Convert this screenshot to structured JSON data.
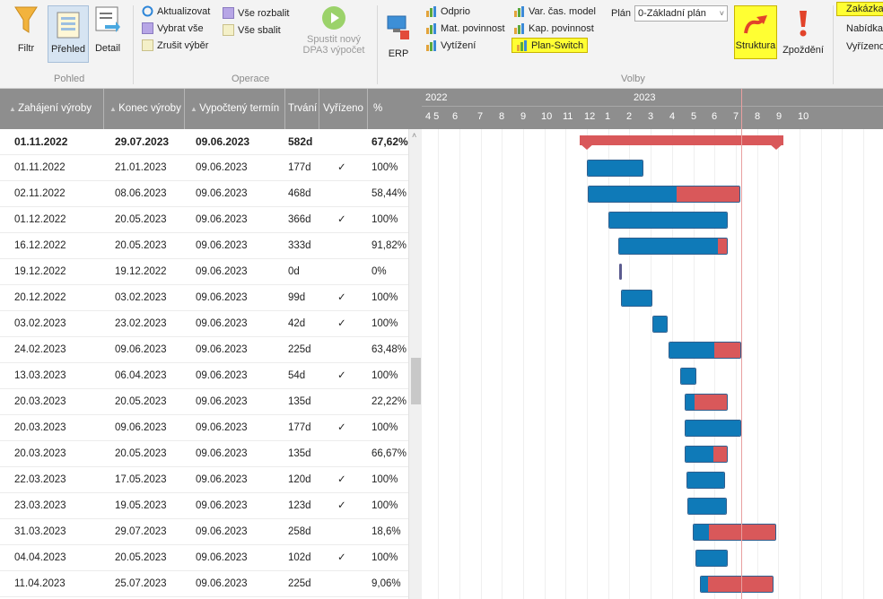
{
  "ribbon": {
    "filtr": "Filtr",
    "prehled": "Přehled",
    "detail": "Detail",
    "pohled": "Pohled",
    "aktualizovat": "Aktualizovat",
    "vybrat_vse": "Vybrat vše",
    "zrusit_vyber": "Zrušit výběr",
    "vse_rozbalit": "Vše rozbalit",
    "vse_sbalit": "Vše sbalit",
    "spustit_1": "Spustit nový",
    "spustit_2": "DPA3 výpočet",
    "operace": "Operace",
    "erp": "ERP",
    "odprio": "Odprio",
    "mat_povinnost": "Mat. povinnost",
    "vytizeni": "Vytížení",
    "var_cas_model": "Var. čas. model",
    "kap_povinnost": "Kap. povinnost",
    "plan_switch": "Plan-Switch",
    "plan_label": "Plán",
    "plan_value": "0-Základní plán",
    "volby": "Volby",
    "struktura": "Struktura",
    "zpozdeni": "Zpoždění",
    "zakazka": "Zakázka",
    "nabidka": "Nabídka",
    "vyrizeno": "Vyřízeno"
  },
  "columns": {
    "zahajeni": "Zahájení výroby",
    "konec": "Konec výroby",
    "vypocteny": "Vypočtený termín",
    "trvani": "Trvání",
    "vyrizeno": "Vyřízeno",
    "pct": "%"
  },
  "timeline": {
    "year1": "2022",
    "year2": "2023",
    "months": [
      "4 5",
      "6",
      "7",
      "8",
      "9",
      "10",
      "11",
      "12",
      "1",
      "2",
      "3",
      "4",
      "5",
      "6",
      "7",
      "8",
      "9",
      "10"
    ]
  },
  "rows": [
    {
      "start": "01.11.2022",
      "end": "29.07.2023",
      "calc": "09.06.2023",
      "dur": "582d",
      "done": "",
      "pct": "67,62%",
      "bold": true,
      "summary": true,
      "sd": "2022-11-01",
      "ed": "2023-07-29"
    },
    {
      "start": "01.11.2022",
      "end": "21.01.2023",
      "calc": "09.06.2023",
      "dur": "177d",
      "done": "✓",
      "pct": "100%",
      "pct_value": 1.0,
      "sd": "2022-11-01",
      "ed": "2023-01-21"
    },
    {
      "start": "02.11.2022",
      "end": "08.06.2023",
      "calc": "09.06.2023",
      "dur": "468d",
      "done": "",
      "pct": "58,44%",
      "pct_value": 0.5844,
      "sd": "2022-11-02",
      "ed": "2023-06-08"
    },
    {
      "start": "01.12.2022",
      "end": "20.05.2023",
      "calc": "09.06.2023",
      "dur": "366d",
      "done": "✓",
      "pct": "100%",
      "pct_value": 1.0,
      "sd": "2022-12-01",
      "ed": "2023-05-20"
    },
    {
      "start": "16.12.2022",
      "end": "20.05.2023",
      "calc": "09.06.2023",
      "dur": "333d",
      "done": "",
      "pct": "91,82%",
      "pct_value": 0.9182,
      "sd": "2022-12-16",
      "ed": "2023-05-20"
    },
    {
      "start": "19.12.2022",
      "end": "19.12.2022",
      "calc": "09.06.2023",
      "dur": "0d",
      "done": "",
      "pct": "0%",
      "pct_value": 0,
      "milestone": true,
      "sd": "2022-12-19",
      "ed": "2022-12-19"
    },
    {
      "start": "20.12.2022",
      "end": "03.02.2023",
      "calc": "09.06.2023",
      "dur": "99d",
      "done": "✓",
      "pct": "100%",
      "pct_value": 1.0,
      "sd": "2022-12-20",
      "ed": "2023-02-03"
    },
    {
      "start": "03.02.2023",
      "end": "23.02.2023",
      "calc": "09.06.2023",
      "dur": "42d",
      "done": "✓",
      "pct": "100%",
      "pct_value": 1.0,
      "sd": "2023-02-03",
      "ed": "2023-02-23"
    },
    {
      "start": "24.02.2023",
      "end": "09.06.2023",
      "calc": "09.06.2023",
      "dur": "225d",
      "done": "",
      "pct": "63,48%",
      "pct_value": 0.6348,
      "sd": "2023-02-24",
      "ed": "2023-06-09"
    },
    {
      "start": "13.03.2023",
      "end": "06.04.2023",
      "calc": "09.06.2023",
      "dur": "54d",
      "done": "✓",
      "pct": "100%",
      "pct_value": 1.0,
      "sd": "2023-03-13",
      "ed": "2023-04-06"
    },
    {
      "start": "20.03.2023",
      "end": "20.05.2023",
      "calc": "09.06.2023",
      "dur": "135d",
      "done": "",
      "pct": "22,22%",
      "pct_value": 0.2222,
      "sd": "2023-03-20",
      "ed": "2023-05-20"
    },
    {
      "start": "20.03.2023",
      "end": "09.06.2023",
      "calc": "09.06.2023",
      "dur": "177d",
      "done": "✓",
      "pct": "100%",
      "pct_value": 1.0,
      "sd": "2023-03-20",
      "ed": "2023-06-09"
    },
    {
      "start": "20.03.2023",
      "end": "20.05.2023",
      "calc": "09.06.2023",
      "dur": "135d",
      "done": "",
      "pct": "66,67%",
      "pct_value": 0.6667,
      "sd": "2023-03-20",
      "ed": "2023-05-20"
    },
    {
      "start": "22.03.2023",
      "end": "17.05.2023",
      "calc": "09.06.2023",
      "dur": "120d",
      "done": "✓",
      "pct": "100%",
      "pct_value": 1.0,
      "sd": "2023-03-22",
      "ed": "2023-05-17"
    },
    {
      "start": "23.03.2023",
      "end": "19.05.2023",
      "calc": "09.06.2023",
      "dur": "123d",
      "done": "✓",
      "pct": "100%",
      "pct_value": 1.0,
      "sd": "2023-03-23",
      "ed": "2023-05-19"
    },
    {
      "start": "31.03.2023",
      "end": "29.07.2023",
      "calc": "09.06.2023",
      "dur": "258d",
      "done": "",
      "pct": "18,6%",
      "pct_value": 0.186,
      "sd": "2023-03-31",
      "ed": "2023-07-29"
    },
    {
      "start": "04.04.2023",
      "end": "20.05.2023",
      "calc": "09.06.2023",
      "dur": "102d",
      "done": "✓",
      "pct": "100%",
      "pct_value": 1.0,
      "sd": "2023-04-04",
      "ed": "2023-05-20"
    },
    {
      "start": "11.04.2023",
      "end": "25.07.2023",
      "calc": "09.06.2023",
      "dur": "225d",
      "done": "",
      "pct": "9,06%",
      "pct_value": 0.0906,
      "sd": "2023-04-11",
      "ed": "2023-07-25"
    }
  ],
  "today_date": "2023-06-09",
  "colors": {
    "done": "#0f7ab8",
    "late": "#d9585a",
    "summary": "#d9585a",
    "milestone": "#5b5b8f",
    "today": "#e8a0a0",
    "highlight": "#ffff33"
  }
}
